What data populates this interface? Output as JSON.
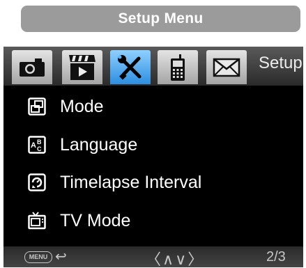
{
  "title": "Setup Menu",
  "tabs": [
    {
      "icon": "camera-icon",
      "active": false
    },
    {
      "icon": "video-icon",
      "active": false
    },
    {
      "icon": "wrench-screwdriver-icon",
      "active": true
    },
    {
      "icon": "cellular-phone-icon",
      "active": false
    },
    {
      "icon": "envelope-icon",
      "active": false
    }
  ],
  "active_tab_label": "Setup",
  "menu_items": [
    {
      "label": "Mode",
      "icon": "mode-icon"
    },
    {
      "label": "Language",
      "icon": "language-icon"
    },
    {
      "label": "Timelapse Interval",
      "icon": "timelapse-icon"
    },
    {
      "label": "TV Mode",
      "icon": "tv-icon"
    }
  ],
  "footer": {
    "menu_button_label": "MENU",
    "back_symbol": "↩",
    "nav_symbols": "〈∧∨〉",
    "page": "2/3"
  }
}
